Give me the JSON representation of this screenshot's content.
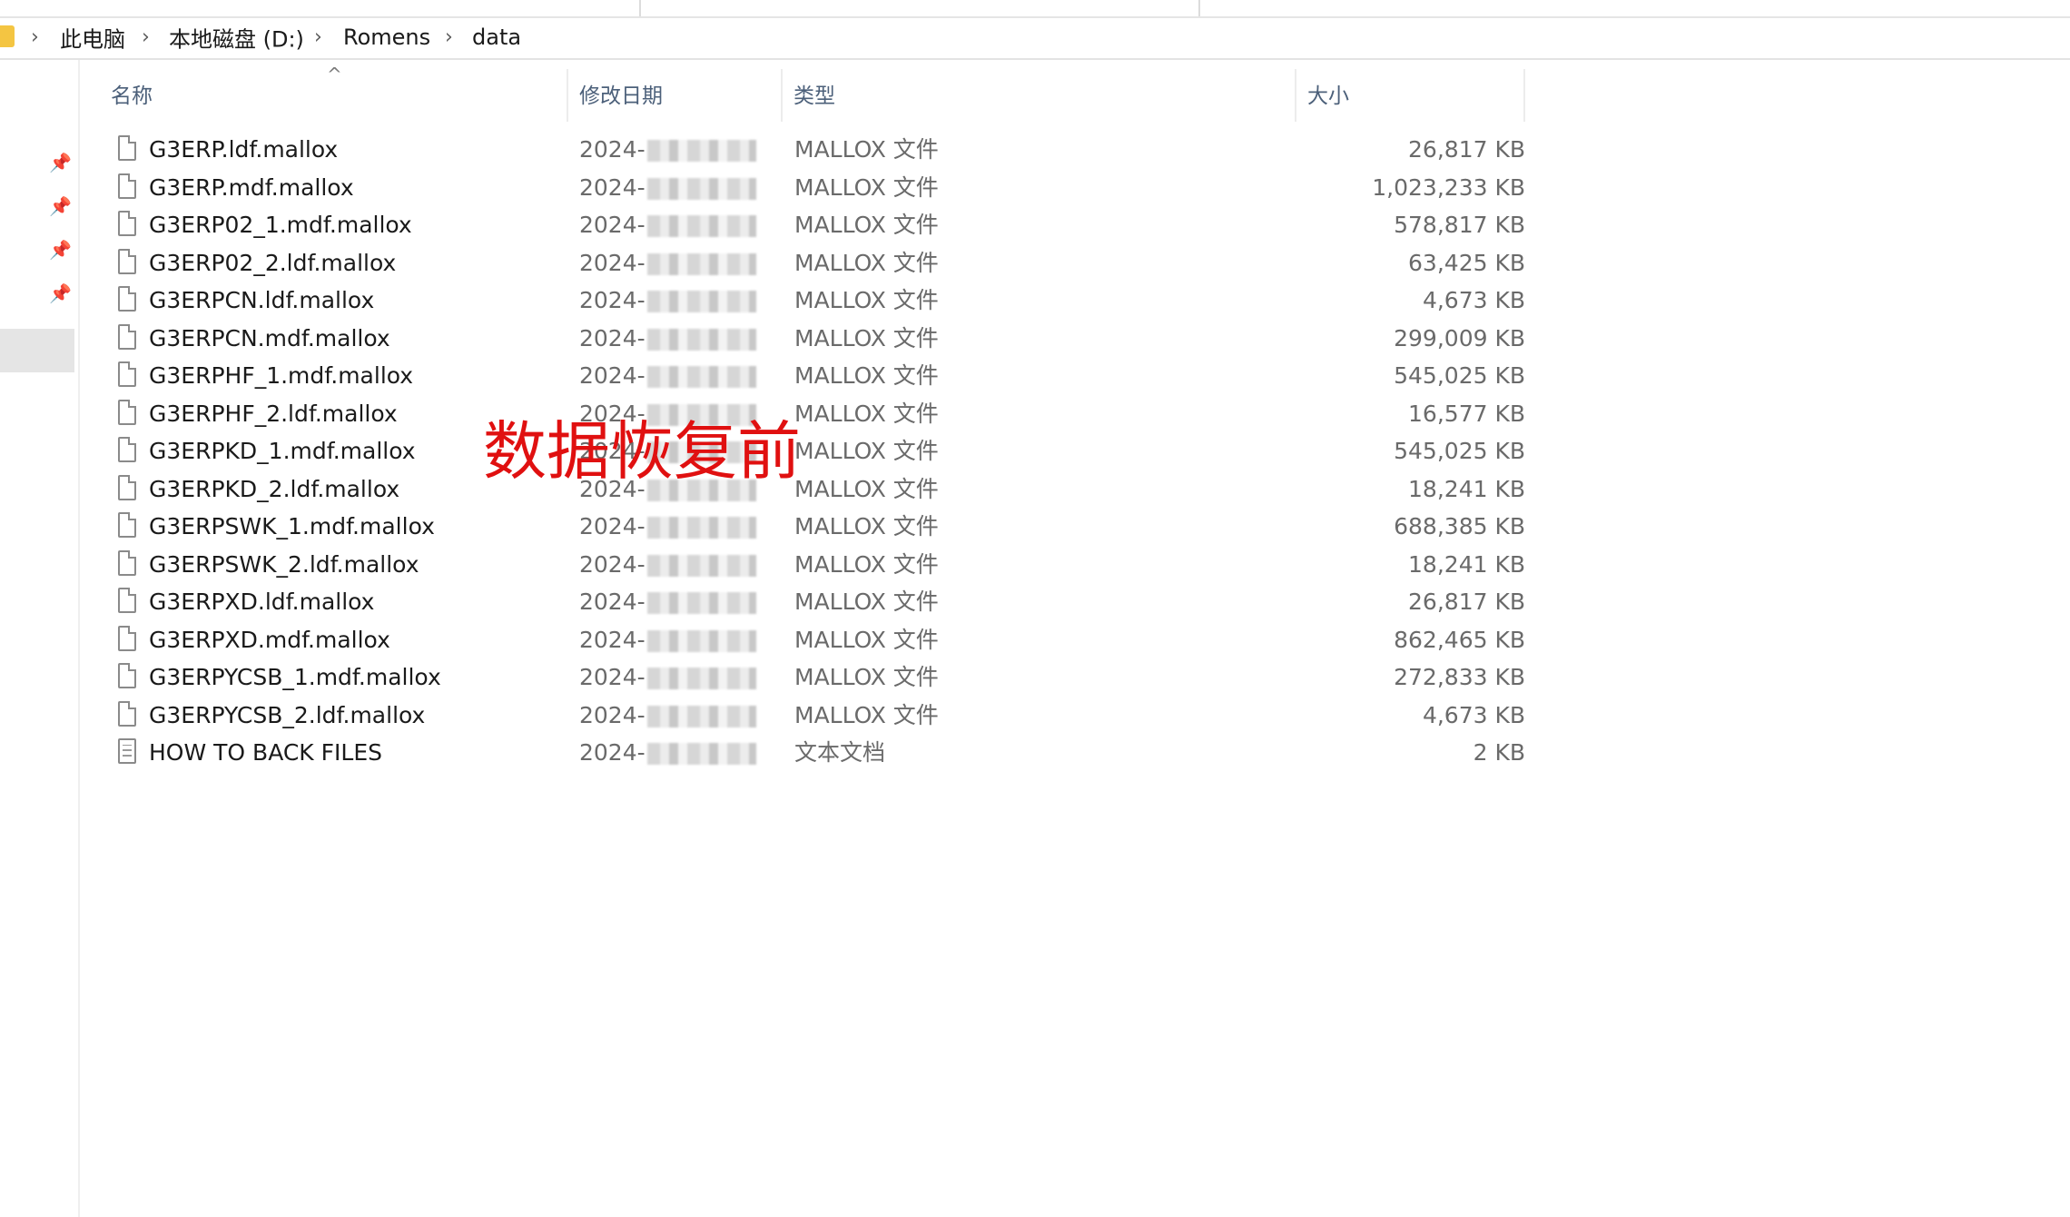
{
  "breadcrumb": [
    "此电脑",
    "本地磁盘 (D:)",
    "Romens",
    "data"
  ],
  "columns": {
    "name": "名称",
    "date": "修改日期",
    "type": "类型",
    "size": "大小"
  },
  "files": [
    {
      "name": "G3ERP.ldf.mallox",
      "date": "2024-",
      "type": "MALLOX 文件",
      "size": "26,817 KB",
      "icon": "file-icon"
    },
    {
      "name": "G3ERP.mdf.mallox",
      "date": "2024-",
      "type": "MALLOX 文件",
      "size": "1,023,233 KB",
      "icon": "file-icon"
    },
    {
      "name": "G3ERP02_1.mdf.mallox",
      "date": "2024-",
      "type": "MALLOX 文件",
      "size": "578,817 KB",
      "icon": "file-icon"
    },
    {
      "name": "G3ERP02_2.ldf.mallox",
      "date": "2024-",
      "type": "MALLOX 文件",
      "size": "63,425 KB",
      "icon": "file-icon"
    },
    {
      "name": "G3ERPCN.ldf.mallox",
      "date": "2024-",
      "type": "MALLOX 文件",
      "size": "4,673 KB",
      "icon": "file-icon"
    },
    {
      "name": "G3ERPCN.mdf.mallox",
      "date": "2024-",
      "type": "MALLOX 文件",
      "size": "299,009 KB",
      "icon": "file-icon"
    },
    {
      "name": "G3ERPHF_1.mdf.mallox",
      "date": "2024-",
      "type": "MALLOX 文件",
      "size": "545,025 KB",
      "icon": "file-icon"
    },
    {
      "name": "G3ERPHF_2.ldf.mallox",
      "date": "2024-",
      "type": "MALLOX 文件",
      "size": "16,577 KB",
      "icon": "file-icon"
    },
    {
      "name": "G3ERPKD_1.mdf.mallox",
      "date": "2024-",
      "type": "MALLOX 文件",
      "size": "545,025 KB",
      "icon": "file-icon"
    },
    {
      "name": "G3ERPKD_2.ldf.mallox",
      "date": "2024-",
      "type": "MALLOX 文件",
      "size": "18,241 KB",
      "icon": "file-icon"
    },
    {
      "name": "G3ERPSWK_1.mdf.mallox",
      "date": "2024-",
      "type": "MALLOX 文件",
      "size": "688,385 KB",
      "icon": "file-icon"
    },
    {
      "name": "G3ERPSWK_2.ldf.mallox",
      "date": "2024-",
      "type": "MALLOX 文件",
      "size": "18,241 KB",
      "icon": "file-icon"
    },
    {
      "name": "G3ERPXD.ldf.mallox",
      "date": "2024-",
      "type": "MALLOX 文件",
      "size": "26,817 KB",
      "icon": "file-icon"
    },
    {
      "name": "G3ERPXD.mdf.mallox",
      "date": "2024-",
      "type": "MALLOX 文件",
      "size": "862,465 KB",
      "icon": "file-icon"
    },
    {
      "name": "G3ERPYCSB_1.mdf.mallox",
      "date": "2024-",
      "type": "MALLOX 文件",
      "size": "272,833 KB",
      "icon": "file-icon"
    },
    {
      "name": "G3ERPYCSB_2.ldf.mallox",
      "date": "2024-",
      "type": "MALLOX 文件",
      "size": "4,673 KB",
      "icon": "file-icon"
    },
    {
      "name": "HOW TO BACK FILES",
      "date": "2024-",
      "type": "文本文档",
      "size": "2 KB",
      "icon": "text-document-icon"
    }
  ],
  "overlay_caption": "数据恢复前",
  "colors": {
    "overlay": "#e01010",
    "header_text": "#4c607a",
    "folder": "#f4c542"
  }
}
